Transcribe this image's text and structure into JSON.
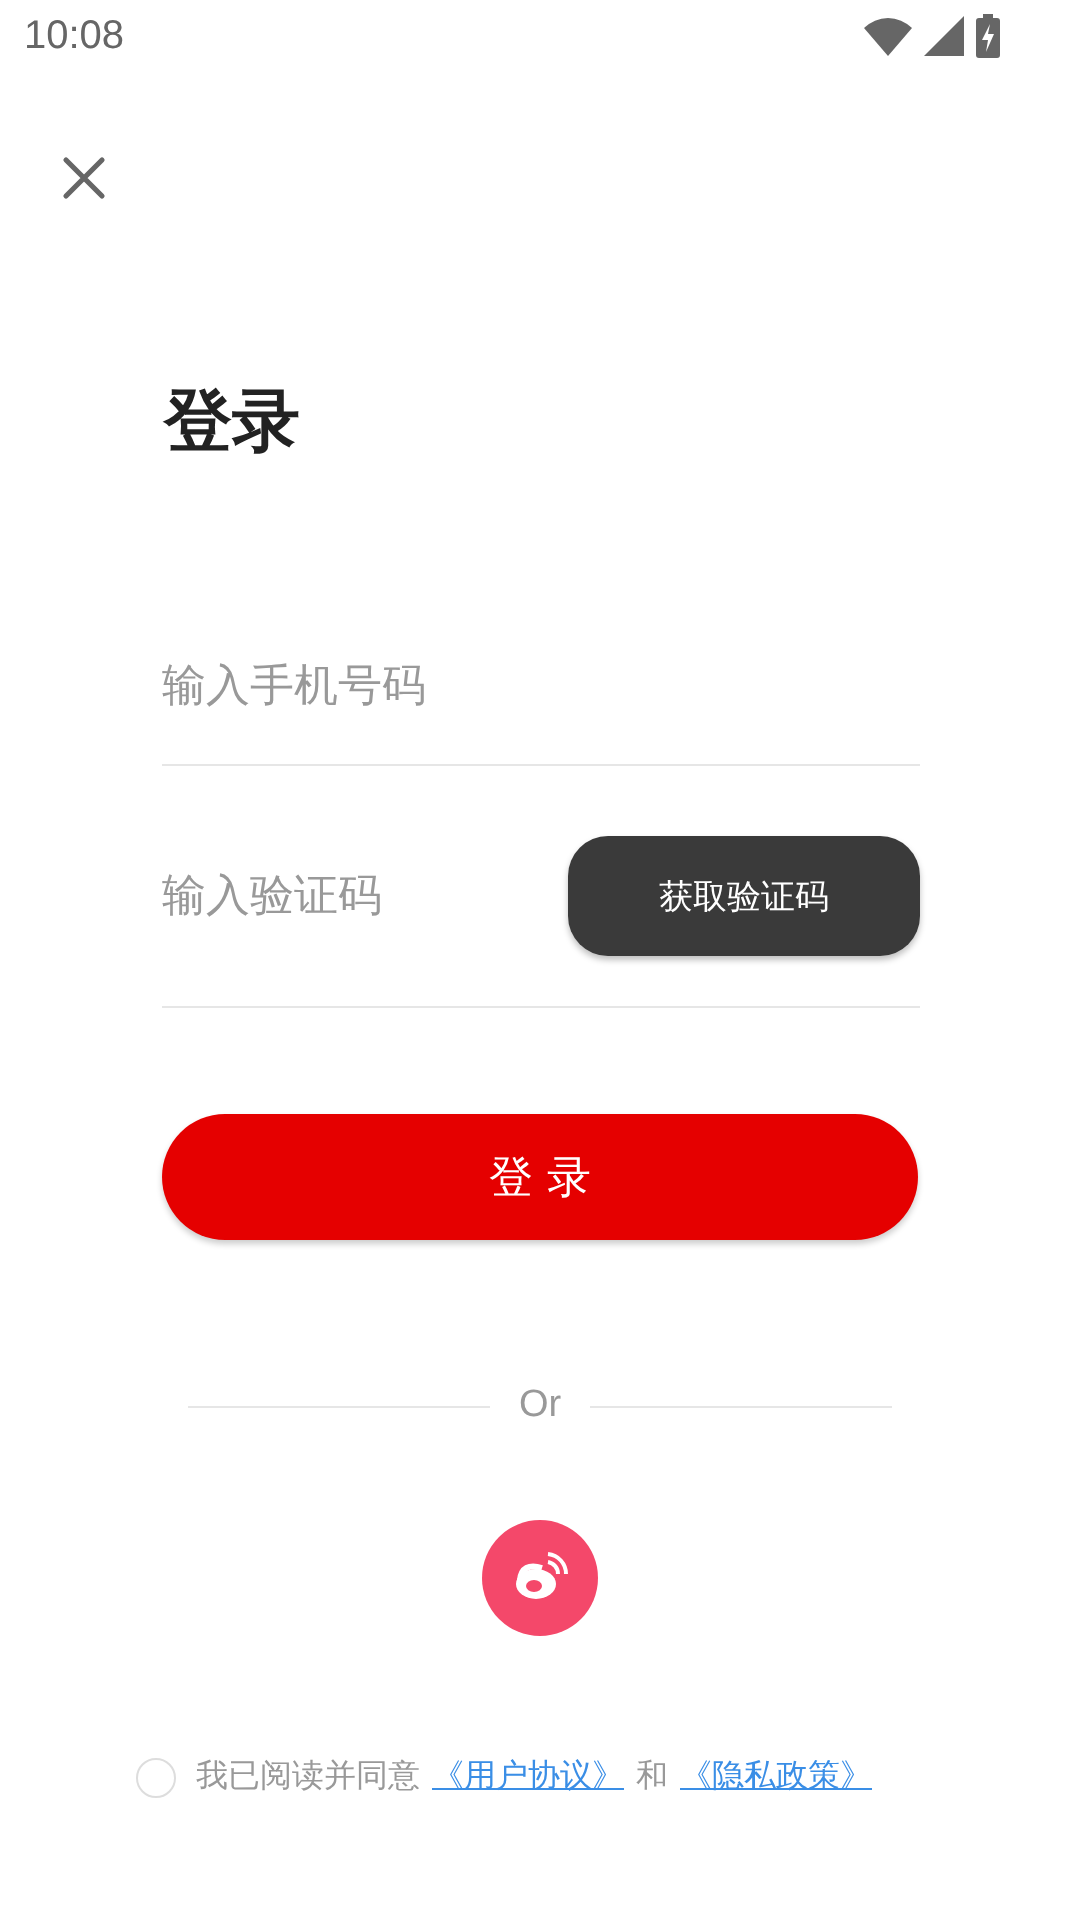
{
  "status_bar": {
    "time": "10:08"
  },
  "title": "登录",
  "phone_field": {
    "placeholder": "输入手机号码"
  },
  "code_field": {
    "placeholder": "输入验证码"
  },
  "get_code_button": "获取验证码",
  "login_button": "登 录",
  "divider_text": "Or",
  "agreement": {
    "checked": false,
    "text": "我已阅读并同意",
    "user_agreement": "《用户协议》",
    "and": "和",
    "privacy_policy": "《隐私政策》"
  }
}
